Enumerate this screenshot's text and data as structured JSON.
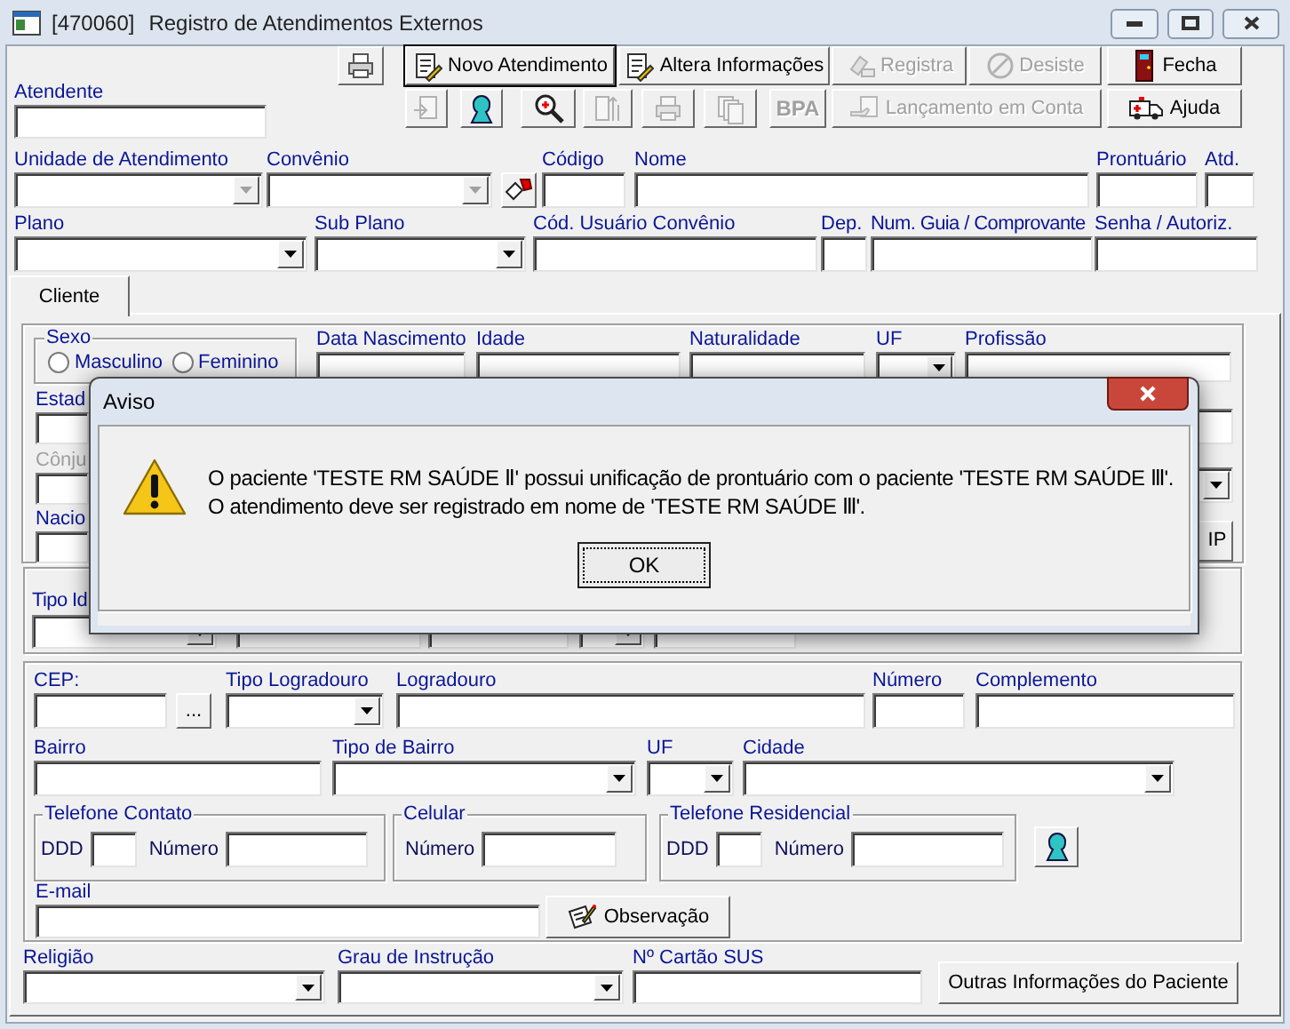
{
  "window": {
    "id_tag": "[470060]",
    "title": "Registro de Atendimentos Externos"
  },
  "toolbar": {
    "rows": [
      [
        {
          "kind": "icon",
          "disabled": false,
          "focused": false
        },
        {
          "kind": "text",
          "label": "Novo Atendimento",
          "disabled": false,
          "focused": true
        },
        {
          "kind": "text",
          "label": "Altera Informações",
          "disabled": false,
          "focused": false
        },
        {
          "kind": "text",
          "label": "Registra",
          "disabled": true,
          "focused": false
        },
        {
          "kind": "text",
          "label": "Desiste",
          "disabled": true,
          "focused": false
        },
        {
          "kind": "text",
          "label": "Fecha",
          "disabled": false,
          "focused": false
        }
      ],
      [
        {
          "kind": "icon",
          "disabled": true,
          "focused": false
        },
        {
          "kind": "icon",
          "disabled": false,
          "focused": false
        },
        {
          "kind": "icon",
          "disabled": false,
          "focused": false
        },
        {
          "kind": "icon",
          "disabled": true,
          "focused": false
        },
        {
          "kind": "icon",
          "disabled": true,
          "focused": false
        },
        {
          "kind": "icon",
          "disabled": true,
          "focused": false
        },
        {
          "kind": "caption",
          "label": "BPA",
          "disabled": true,
          "focused": false
        },
        {
          "kind": "text",
          "label": "Lançamento em Conta",
          "disabled": true,
          "focused": false
        },
        {
          "kind": "text",
          "label": "Ajuda",
          "disabled": false,
          "focused": false
        }
      ]
    ]
  },
  "header": {
    "fields": [
      {
        "label": "Atendente",
        "kind": "text"
      }
    ]
  },
  "fields": {
    "upper": [
      {
        "label": "Unidade de Atendimento",
        "kind": "combo_locked"
      },
      {
        "label": "Convênio",
        "kind": "combo_locked"
      },
      {
        "kind": "stamp_button"
      },
      {
        "label": "Código",
        "kind": "text"
      },
      {
        "label": "Nome",
        "kind": "text"
      },
      {
        "label": "Prontuário",
        "kind": "text"
      },
      {
        "label": "Atd.",
        "kind": "text"
      }
    ],
    "lower": [
      {
        "label": "Plano",
        "kind": "combo"
      },
      {
        "label": "Sub Plano",
        "kind": "combo"
      },
      {
        "label": "Cód. Usuário Convênio",
        "kind": "text"
      },
      {
        "label": "Dep.",
        "kind": "text"
      },
      {
        "label": "Num. Guia / Comprovante",
        "kind": "text"
      },
      {
        "label": "Senha / Autoriz.",
        "kind": "text"
      }
    ]
  },
  "tabs": [
    {
      "label": "Cliente",
      "selected": true
    }
  ],
  "personal": {
    "sex": {
      "legend": "Sexo",
      "options": [
        {
          "label": "Masculino",
          "selected": false
        },
        {
          "label": "Feminino",
          "selected": false
        }
      ]
    },
    "fields": [
      {
        "label": "Data Nascimento",
        "kind": "text"
      },
      {
        "label": "Idade",
        "kind": "text"
      },
      {
        "label": "Naturalidade",
        "kind": "text"
      },
      {
        "label": "UF",
        "kind": "combo"
      },
      {
        "label": "Profissão",
        "kind": "text"
      }
    ],
    "left": [
      {
        "label": "Estad",
        "disabled": false
      },
      {
        "label": "Cônju",
        "disabled": true
      },
      {
        "label": "Nacio",
        "disabled": false
      }
    ],
    "right": [
      {
        "kind": "text"
      },
      {
        "kind": "combo"
      },
      {
        "kind": "button",
        "label": "IP"
      }
    ]
  },
  "documents": {
    "label": "Tipo Id",
    "fields": [
      {
        "kind": "combo"
      },
      {
        "kind": "text"
      },
      {
        "kind": "text"
      },
      {
        "kind": "combo"
      },
      {
        "kind": "text"
      }
    ]
  },
  "address": {
    "street": [
      {
        "label": "CEP:",
        "kind": "text"
      },
      {
        "kind": "ellipsis_button",
        "label": "..."
      },
      {
        "label": "Tipo Logradouro",
        "kind": "combo"
      },
      {
        "label": "Logradouro",
        "kind": "text"
      },
      {
        "label": "Número",
        "kind": "text"
      },
      {
        "label": "Complemento",
        "kind": "text"
      }
    ],
    "district": [
      {
        "label": "Bairro",
        "kind": "text"
      },
      {
        "label": "Tipo de Bairro",
        "kind": "combo"
      },
      {
        "label": "UF",
        "kind": "combo"
      },
      {
        "label": "Cidade",
        "kind": "combo"
      }
    ],
    "phones": [
      {
        "legend": "Telefone Contato",
        "fields": [
          {
            "label": "DDD"
          },
          {
            "label": "Número"
          }
        ]
      },
      {
        "legend": "Celular",
        "fields": [
          {
            "label": "Número"
          }
        ]
      },
      {
        "legend": "Telefone Residencial",
        "fields": [
          {
            "label": "DDD"
          },
          {
            "label": "Número"
          }
        ]
      }
    ],
    "email": {
      "label": "E-mail"
    },
    "observation_button": {
      "label": "Observação"
    }
  },
  "extra": {
    "fields": [
      {
        "label": "Religião",
        "kind": "combo"
      },
      {
        "label": "Grau de Instrução",
        "kind": "combo"
      },
      {
        "label": "Nº Cartão SUS",
        "kind": "text"
      }
    ],
    "button": {
      "label": "Outras Informações do Paciente"
    }
  },
  "dialog": {
    "title": "Aviso",
    "message_lines": [
      "O paciente 'TESTE RM SAÚDE Ⅱ' possui unificação de prontuário com o paciente 'TESTE RM SAÚDE Ⅲ'.",
      "O atendimento deve ser registrado em nome de 'TESTE RM SAÚDE Ⅲ'."
    ],
    "button": {
      "label": "OK",
      "focused": true
    }
  }
}
